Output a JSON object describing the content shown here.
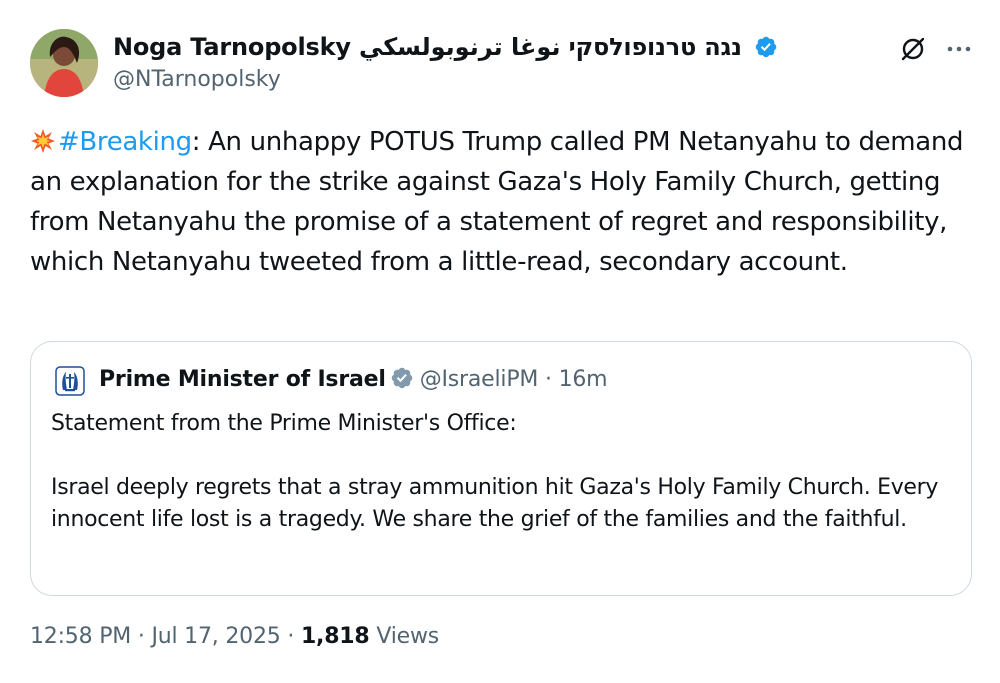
{
  "author": {
    "name": "Noga Tarnopolsky נגה טרנופולסקי نوغا ترنوبولسكي",
    "handle": "@NTarnopolsky"
  },
  "tweet": {
    "hashtag": "#Breaking",
    "text_after_hashtag": ": An unhappy POTUS Trump called PM Netanyahu to demand an explanation for the strike against Gaza's Holy Family Church, getting from Netanyahu the promise of a statement of regret and responsibility, which Netanyahu tweeted from a little-read, secondary account."
  },
  "quoted_tweet": {
    "name": "Prime Minister of Israel",
    "handle": "@IsraeliPM",
    "separator": "·",
    "time": "16m",
    "paragraph_1": "Statement from the Prime Minister's Office:",
    "paragraph_2": "Israel deeply regrets that a stray ammunition hit Gaza's Holy Family Church. Every innocent life lost is a tragedy. We share the grief of the families and the faithful."
  },
  "footer": {
    "time": "12:58 PM",
    "separator_1": "·",
    "date": "Jul 17, 2025",
    "separator_2": "·",
    "views_count": "1,818",
    "views_label": "Views"
  },
  "icons": {
    "emoji": "collision-emoji",
    "verified_blue": "verified-badge-icon",
    "verified_gray": "verified-gray-badge-icon",
    "grok": "grok-icon",
    "more": "more-icon",
    "emblem": "israel-emblem-icon"
  },
  "colors": {
    "text": "#0f1419",
    "secondary": "#536471",
    "link": "#1d9bf0",
    "border": "#cfd9de",
    "verified_gray": "#829aab"
  }
}
